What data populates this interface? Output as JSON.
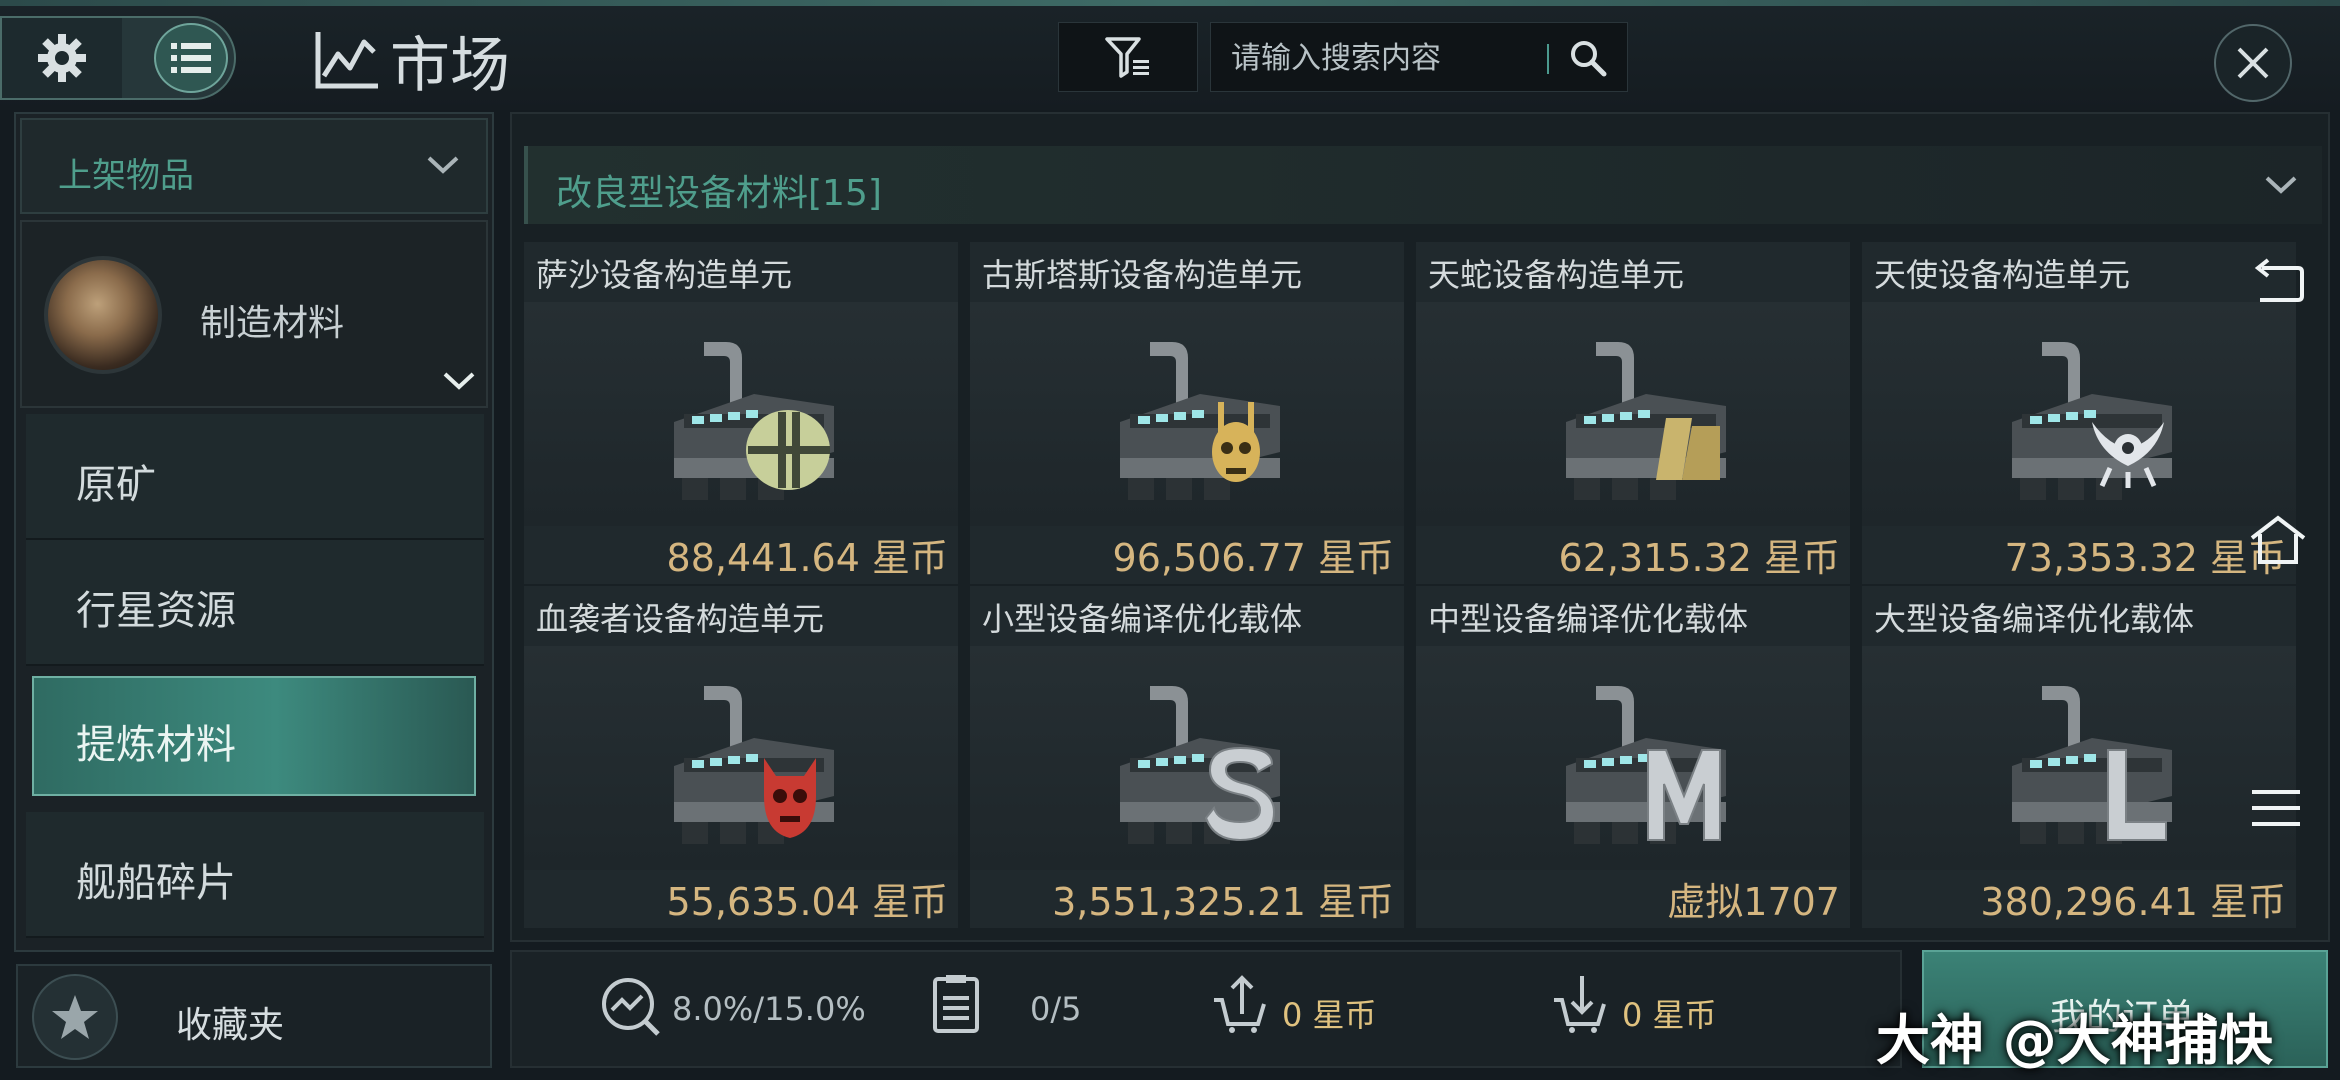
{
  "header": {
    "title": "市场",
    "search_placeholder": "请输入搜索内容"
  },
  "sidebar": {
    "listing_dropdown": "上架物品",
    "category": "制造材料",
    "items": [
      {
        "label": "原矿",
        "active": false
      },
      {
        "label": "行星资源",
        "active": false
      },
      {
        "label": "提炼材料",
        "active": true
      },
      {
        "label": "舰船碎片",
        "active": false
      }
    ],
    "favorites": "收藏夹"
  },
  "group": {
    "title": "改良型设备材料[15]"
  },
  "products": [
    {
      "name": "萨沙设备构造单元",
      "price": "88,441.64 星币",
      "emblem": "sansha-emblem"
    },
    {
      "name": "古斯塔斯设备构造单元",
      "price": "96,506.77 星币",
      "emblem": "guristas-skull-emblem"
    },
    {
      "name": "天蛇设备构造单元",
      "price": "62,315.32 星币",
      "emblem": "serpentis-emblem"
    },
    {
      "name": "天使设备构造单元",
      "price": "73,353.32 星币",
      "emblem": "angel-emblem"
    },
    {
      "name": "血袭者设备构造单元",
      "price": "55,635.04 星币",
      "emblem": "blood-raider-skull-emblem"
    },
    {
      "name": "小型设备编译优化载体",
      "price": "3,551,325.21 星币",
      "emblem": "letter-s"
    },
    {
      "name": "中型设备编译优化载体",
      "price": "虚拟1707",
      "emblem": "letter-m"
    },
    {
      "name": "大型设备编译优化载体",
      "price": "380,296.41 星币",
      "emblem": "letter-l"
    }
  ],
  "bottom_bar": {
    "tax": "8.0%/15.0%",
    "orders_count": "0/5",
    "sell_amount": "0 星币",
    "buy_amount": "0 星币",
    "my_orders": "我的订单"
  },
  "watermark": "大神 @大神捕快",
  "colors": {
    "accent": "#4f9e8c",
    "price_gold": "#d5b680",
    "active_tab": "#3d8a7e",
    "background": "#141b20"
  }
}
